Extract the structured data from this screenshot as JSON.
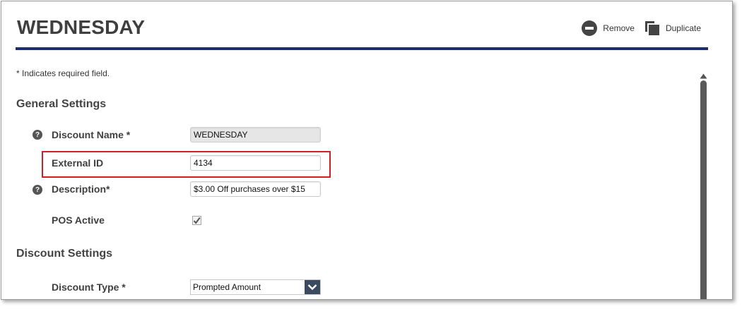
{
  "header": {
    "title": "WEDNESDAY",
    "remove_label": "Remove",
    "duplicate_label": "Duplicate"
  },
  "form": {
    "required_note": "* Indicates required field.",
    "general_settings": {
      "title": "General Settings",
      "discount_name_label": "Discount Name *",
      "discount_name_value": "WEDNESDAY",
      "external_id_label": "External ID",
      "external_id_value": "4134",
      "description_label": "Description*",
      "description_value": "$3.00 Off purchases over $15",
      "pos_active_label": "POS Active",
      "pos_active_checked": true
    },
    "discount_settings": {
      "title": "Discount Settings",
      "discount_type_label": "Discount Type *",
      "discount_type_value": "Prompted Amount"
    }
  },
  "icons": {
    "remove": "minus-circle-icon",
    "duplicate": "duplicate-icon",
    "help": "question-circle-icon",
    "dropdown": "chevron-down-icon",
    "checkbox": "checkmark-icon",
    "scroll_up": "triangle-up-icon"
  },
  "colors": {
    "title_rule": "#1c2f6b",
    "highlight": "#d21f1f",
    "dropdown_button": "#3b4a5f"
  }
}
